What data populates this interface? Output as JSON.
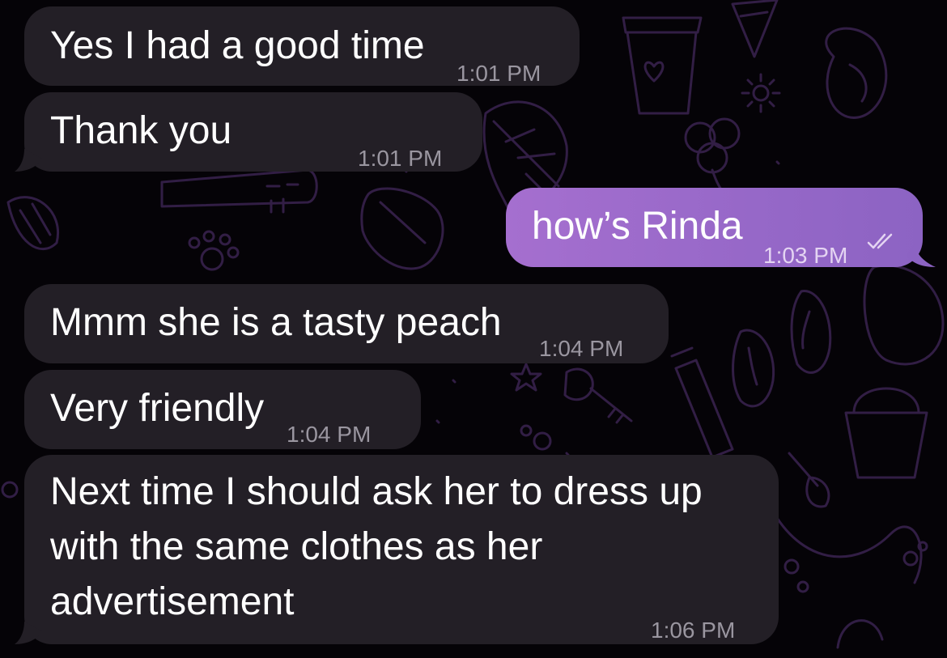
{
  "messages": [
    {
      "text": "Yes I had a good time",
      "time": "1:01 PM",
      "direction": "incoming"
    },
    {
      "text": "Thank you",
      "time": "1:01 PM",
      "direction": "incoming"
    },
    {
      "text": "how’s Rinda",
      "time": "1:03 PM",
      "direction": "outgoing",
      "status": "read",
      "status_icon": "double-check-icon"
    },
    {
      "text": "Mmm she is a tasty peach",
      "time": "1:04 PM",
      "direction": "incoming"
    },
    {
      "text": "Very friendly",
      "time": "1:04 PM",
      "direction": "incoming"
    },
    {
      "text_lines": [
        "Next time I should ask her to dress up",
        "with the same clothes as her",
        "advertisement"
      ],
      "time": "1:06 PM",
      "direction": "incoming"
    }
  ],
  "colors": {
    "background": "#050307",
    "incoming_bubble": "#231f26",
    "outgoing_bubble_start": "#a56fcf",
    "outgoing_bubble_end": "#8c63c3",
    "wallpaper_doodle": "#3a2350",
    "timestamp_incoming": "#9a96a0",
    "timestamp_outgoing": "#e4d4f2"
  }
}
